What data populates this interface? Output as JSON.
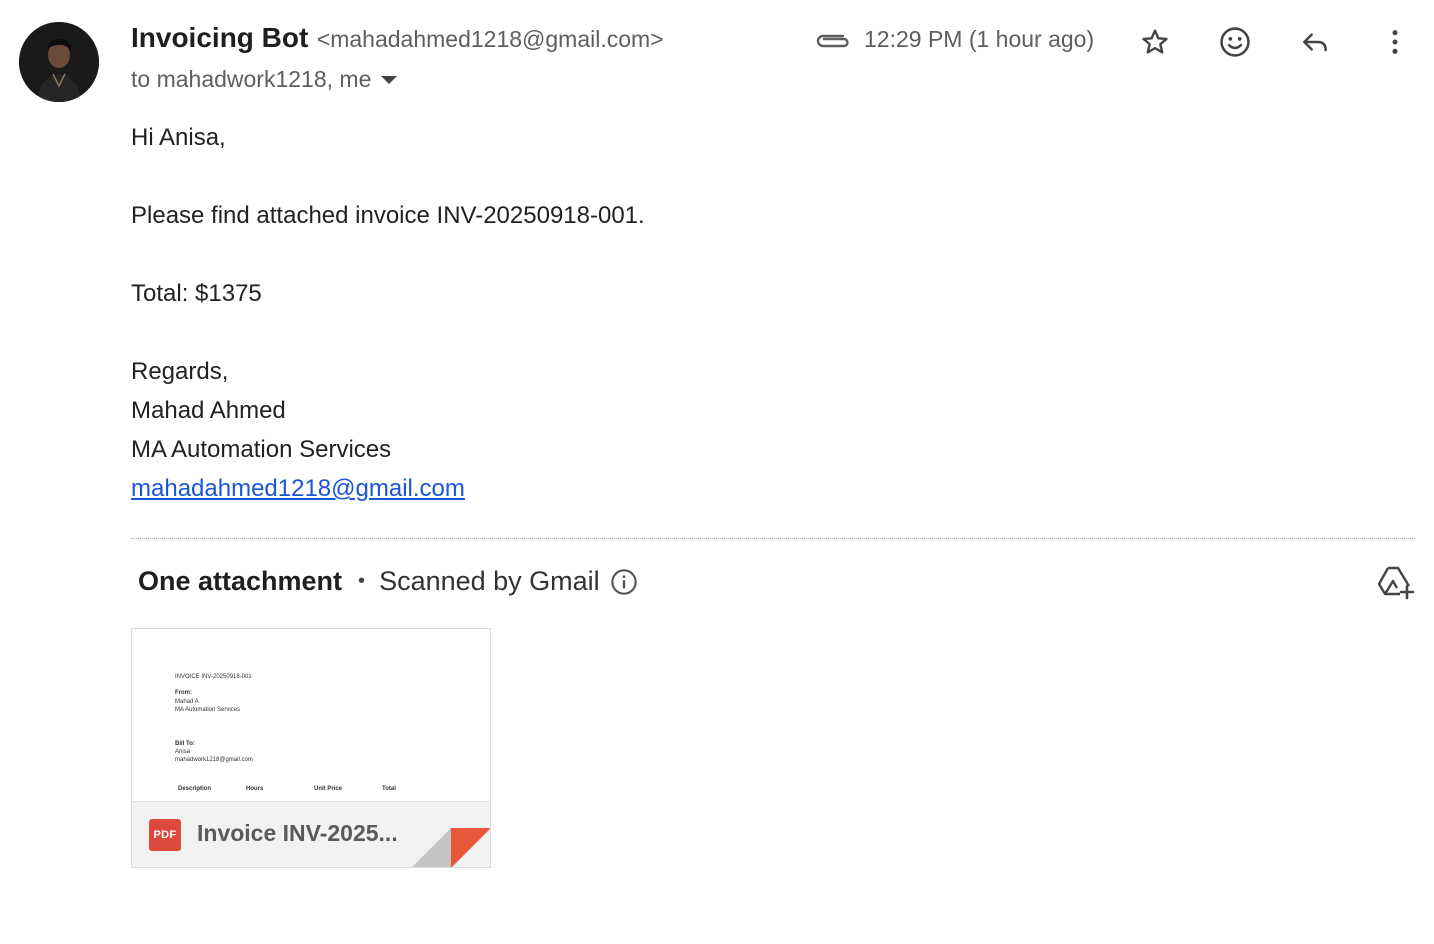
{
  "header": {
    "sender_name": "Invoicing Bot",
    "sender_email": "<mahadahmed1218@gmail.com>",
    "recipients": "to mahadwork1218, me",
    "time": "12:29 PM (1 hour ago)",
    "icons": [
      "attachment-icon",
      "star-icon",
      "emoji-icon",
      "reply-icon",
      "more-icon",
      "chevron-down-icon"
    ]
  },
  "body": {
    "greeting": "Hi Anisa,",
    "line1": "Please find attached invoice INV-20250918-001.",
    "total": "Total: $1375",
    "regards": "Regards,",
    "name": "Mahad Ahmed",
    "company": "MA Automation Services",
    "email_link": "mahadahmed1218@gmail.com"
  },
  "attachments": {
    "title": "One attachment",
    "separator": "•",
    "scanned": "Scanned by Gmail",
    "file_badge": "PDF",
    "file_name": "Invoice INV-2025...",
    "preview": {
      "title": "INVOICE INV-20250918-001",
      "from_label": "From:",
      "from_name": "Mahad A",
      "from_company": "MA Automation Services",
      "bill_label": "Bill To:",
      "bill_name": "Anisa",
      "bill_email": "mahadwork1218@gmail.com",
      "col_description": "Description",
      "col_hours": "Hours",
      "col_unit_price": "Unit Price",
      "col_total": "Total"
    }
  },
  "colors": {
    "link": "#1a55d6",
    "pdf_red": "#dd4a3b",
    "fold_orange": "#e8593c",
    "muted_text": "#5e5e5e"
  }
}
